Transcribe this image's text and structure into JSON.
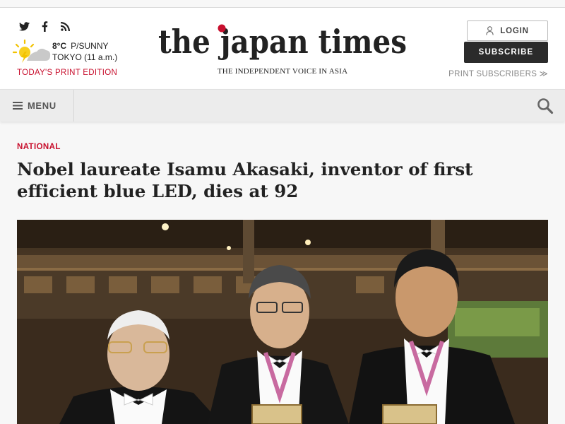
{
  "header": {
    "social": [
      {
        "name": "twitter-icon"
      },
      {
        "name": "facebook-icon"
      },
      {
        "name": "rss-icon"
      }
    ],
    "weather": {
      "icon": "partly-sunny-icon",
      "temp": "8°C",
      "condition": "P/SUNNY",
      "location": "TOKYO (11 a.m.)"
    },
    "print_edition_label": "TODAY'S PRINT EDITION",
    "logo_text": "the japan times",
    "tagline": "THE INDEPENDENT VOICE IN ASIA",
    "login_label": "LOGIN",
    "subscribe_label": "SUBSCRIBE",
    "print_subscribers_label": "PRINT SUBSCRIBERS ≫"
  },
  "nav": {
    "menu_label": "MENU",
    "search_icon": "search-icon"
  },
  "article": {
    "category": "NATIONAL",
    "headline": "Nobel laureate Isamu Akasaki, inventor of first efficient blue LED, dies at 92"
  },
  "colors": {
    "brand_red": "#c8102e",
    "subscribe_bg": "#2b2b2b",
    "nav_bg": "#ececec"
  }
}
